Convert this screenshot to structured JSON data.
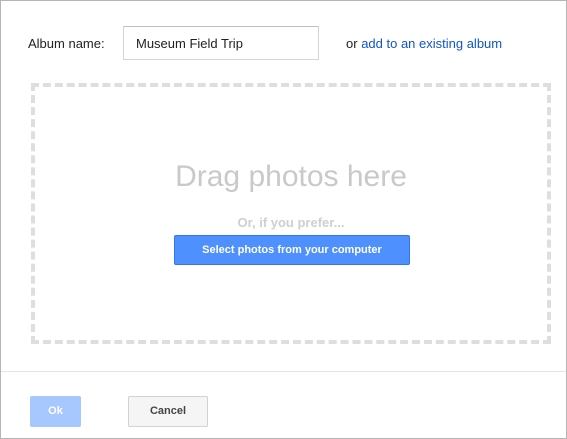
{
  "album": {
    "label": "Album name:",
    "value": "Museum Field Trip",
    "or_text": "or",
    "existing_link": "add to an existing album"
  },
  "dropzone": {
    "title": "Drag photos here",
    "prefer": "Or, if you prefer...",
    "select_button": "Select photos from your computer"
  },
  "footer": {
    "ok_label": "Ok",
    "ok_disabled": true,
    "cancel_label": "Cancel"
  },
  "colors": {
    "primary_button": "#4d90fe",
    "disabled_button": "#a6c8ff",
    "link": "#1155cc"
  }
}
